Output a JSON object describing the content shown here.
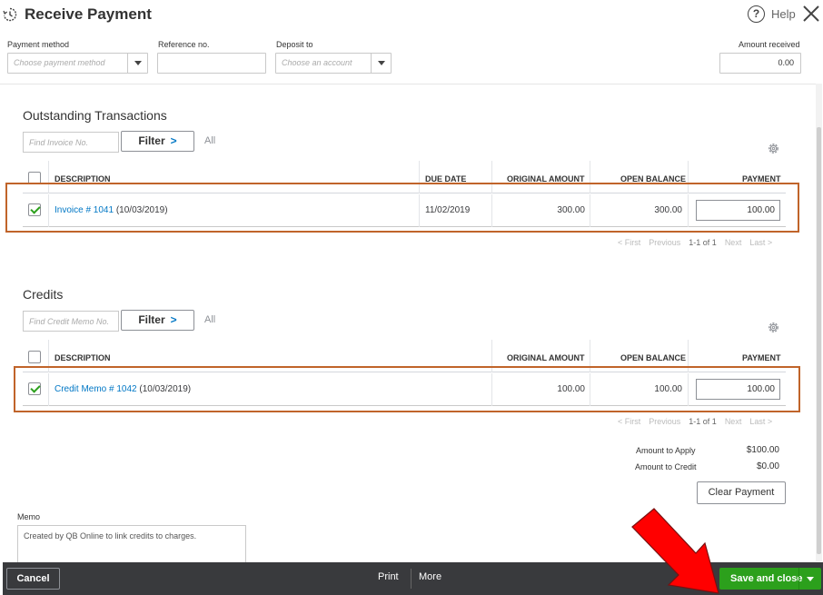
{
  "header": {
    "title": "Receive Payment",
    "help_label": "Help"
  },
  "form": {
    "payment_method": {
      "label": "Payment method",
      "placeholder": "Choose payment method"
    },
    "reference_no": {
      "label": "Reference no.",
      "value": ""
    },
    "deposit_to": {
      "label": "Deposit to",
      "placeholder": "Choose an account"
    },
    "amount_received": {
      "label": "Amount received",
      "value": "0.00"
    }
  },
  "outstanding": {
    "title": "Outstanding Transactions",
    "find_placeholder": "Find Invoice No.",
    "filter_label": "Filter",
    "filter_chevron": ">",
    "all_label": "All",
    "columns": {
      "description": "DESCRIPTION",
      "due_date": "DUE DATE",
      "original_amount": "ORIGINAL AMOUNT",
      "open_balance": "OPEN BALANCE",
      "payment": "PAYMENT"
    },
    "rows": [
      {
        "checked": true,
        "link": "Invoice # 1041",
        "date_suffix": " (10/03/2019)",
        "due_date": "11/02/2019",
        "original_amount": "300.00",
        "open_balance": "300.00",
        "payment": "100.00"
      }
    ],
    "pager": {
      "first": "< First",
      "previous": "Previous",
      "range": "1-1 of 1",
      "next": "Next",
      "last": "Last >"
    }
  },
  "credits": {
    "title": "Credits",
    "find_placeholder": "Find Credit Memo No.",
    "filter_label": "Filter",
    "filter_chevron": ">",
    "all_label": "All",
    "columns": {
      "description": "DESCRIPTION",
      "original_amount": "ORIGINAL AMOUNT",
      "open_balance": "OPEN BALANCE",
      "payment": "PAYMENT"
    },
    "rows": [
      {
        "checked": true,
        "link": "Credit Memo # 1042",
        "date_suffix": " (10/03/2019)",
        "original_amount": "100.00",
        "open_balance": "100.00",
        "payment": "100.00"
      }
    ],
    "pager": {
      "first": "< First",
      "previous": "Previous",
      "range": "1-1 of 1",
      "next": "Next",
      "last": "Last >"
    }
  },
  "summary": {
    "amount_to_apply_label": "Amount to Apply",
    "amount_to_apply": "$100.00",
    "amount_to_credit_label": "Amount to Credit",
    "amount_to_credit": "$0.00",
    "clear_payment_label": "Clear Payment"
  },
  "memo": {
    "label": "Memo",
    "value": "Created by QB Online to link credits to charges."
  },
  "footer": {
    "cancel_label": "Cancel",
    "print_label": "Print",
    "more_label": "More",
    "save_close_label": "Save and close"
  },
  "colors": {
    "accent_green": "#2ca01c",
    "link_blue": "#0077c5",
    "highlight_box": "#c0642a",
    "annotation_arrow": "#ff0000",
    "footer_bg": "#393a3d"
  }
}
